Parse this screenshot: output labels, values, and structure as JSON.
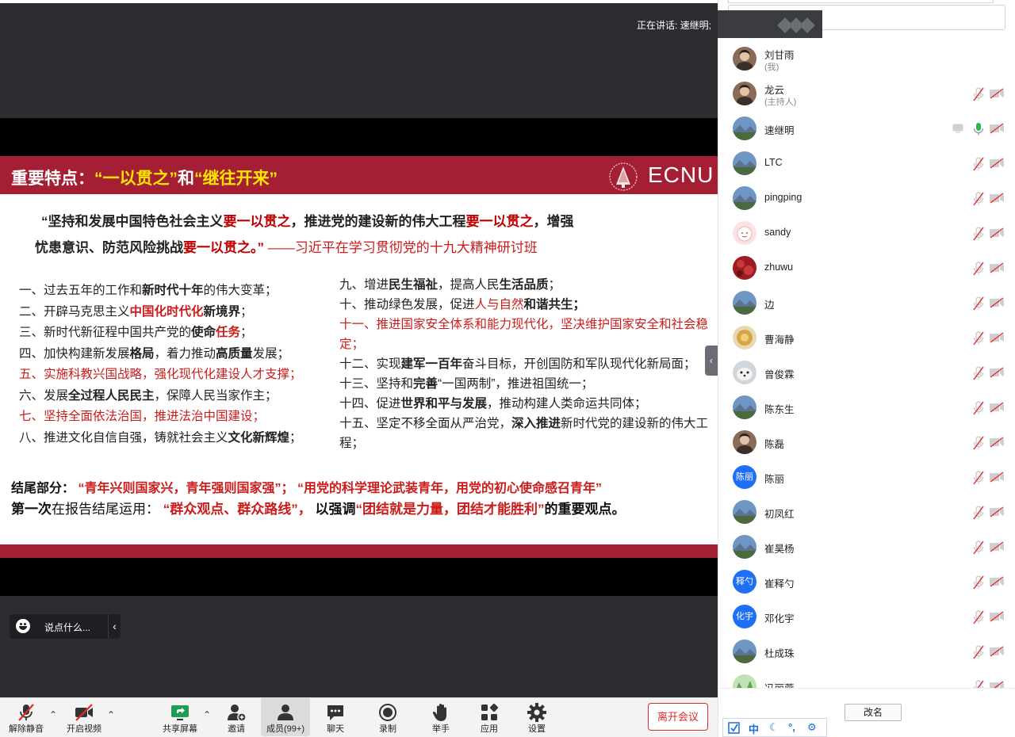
{
  "meeting": {
    "speaking_label": "正在讲话: 速继明;"
  },
  "slide": {
    "title_a": "重要特点：",
    "title_b": "“一以贯之”",
    "title_c": "和",
    "title_d": "“继往开来”",
    "logo_text": "ECNU",
    "quote": {
      "l1_a": "“坚持和发展中国特色社会主义",
      "l1_b": "要一以贯之",
      "l1_c": "，推进党的建设新的伟大工程",
      "l1_d": "要一以贯之",
      "l1_e": "，增强",
      "l2_a": "忧患意识、防范风险挑战",
      "l2_b": "要一以贯之。”",
      "l2_c": "——习近平在学习贯彻党的十九大精神研讨班"
    },
    "left_items": [
      {
        "a": "一、过去五年的工作和",
        "b": "新时代十年",
        "c": "的伟大变革；"
      },
      {
        "a": "二、开辟马克思主义",
        "b": "中国化时代化",
        "c": "新境界",
        "d": "；"
      },
      {
        "a": "三、新时代新征程中国共产党的",
        "b": "使命",
        "c": "任务",
        "d": "；"
      },
      {
        "a": "四、加快构建新发展",
        "b": "格局",
        "c": "，着力推动",
        "d": "高质量",
        "e": "发展；"
      },
      {
        "a": "五、实施科教兴国战略，强化现代化建设人才支撑；"
      },
      {
        "a": "六、发展",
        "b": "全过程人民民主",
        "c": "，保障人民当家作主；"
      },
      {
        "a": "七、坚持全面依法治国，推进法治中国建设；"
      },
      {
        "a": "八、推进文化自信自强，铸就社会主义",
        "b": "文化新辉煌",
        "c": "；"
      }
    ],
    "right_items": [
      {
        "a": "九、增进",
        "b": "民生福祉",
        "c": "，提高人民",
        "d": "生活品质",
        "e": "；"
      },
      {
        "a": "十、推动绿色发展，促进",
        "b": "人与自然",
        "c": "和谐共生",
        "d": "；"
      },
      {
        "a": "十一、推进国家安全体系和能力现代化，坚决维护国家安全和社会稳定；"
      },
      {
        "a": "十二、实现",
        "b": "建军一百年",
        "c": "奋斗目标，开创国防和军队现代化新局面；"
      },
      {
        "a": "十三、坚持和",
        "b": "完善",
        "c": "“一国两制”，推进祖国统一；"
      },
      {
        "a": "十四、促进",
        "b": "世界和平与发展",
        "c": "，推动构建人类命运共同体；"
      },
      {
        "a": "十五、坚定不移全面从严治党，",
        "b": "深入推进",
        "c": "新时代党的建设新的伟大工程；"
      }
    ],
    "ending": {
      "label": "结尾部分：",
      "q1": "“青年兴则国家兴，青年强则国家强”；",
      "q2": "“用党的科学理论武装青年，用党的初心使命感召青年”"
    },
    "first": {
      "a": "第一次",
      "b": "在报告结尾运用：",
      "c": "“群众观点、群众路线”，",
      "d": "以强调",
      "e": "“团结就是力量，团结才能胜利”",
      "f": "的重要观点。"
    }
  },
  "reaction": {
    "placeholder": "说点什么..."
  },
  "toolbar": {
    "mute": "解除静音",
    "video": "开启视频",
    "share": "共享屏幕",
    "invite": "邀请",
    "members": "成员(99+)",
    "chat": "聊天",
    "record": "录制",
    "raise_hand": "举手",
    "apps": "应用",
    "settings": "设置",
    "leave": "离开会议"
  },
  "participants": [
    {
      "name": "刘甘雨",
      "role": "(我)",
      "avatar": "photo-portrait",
      "mic": "none",
      "cam": "none"
    },
    {
      "name": "龙云",
      "role": "(主持人)",
      "avatar": "photo-portrait",
      "mic": "muted",
      "cam": "off"
    },
    {
      "name": "速继明",
      "role": "",
      "avatar": "photo-landscape",
      "mic": "on",
      "cam": "off",
      "sharing": true
    },
    {
      "name": "LTC",
      "role": "",
      "avatar": "photo-landscape",
      "mic": "muted",
      "cam": "off"
    },
    {
      "name": "pingping",
      "role": "",
      "avatar": "photo-landscape",
      "mic": "muted",
      "cam": "off"
    },
    {
      "name": "sandy",
      "role": "",
      "avatar": "photo-cartoon",
      "mic": "muted",
      "cam": "off"
    },
    {
      "name": "zhuwu",
      "role": "",
      "avatar": "photo-red",
      "mic": "muted",
      "cam": "off"
    },
    {
      "name": "边",
      "role": "",
      "avatar": "photo-landscape",
      "mic": "muted",
      "cam": "off"
    },
    {
      "name": "曹海静",
      "role": "",
      "avatar": "photo-yellow",
      "mic": "muted",
      "cam": "off"
    },
    {
      "name": "曾俊霖",
      "role": "",
      "avatar": "photo-animal",
      "mic": "muted",
      "cam": "off"
    },
    {
      "name": "陈东生",
      "role": "",
      "avatar": "photo-landscape",
      "mic": "muted",
      "cam": "off"
    },
    {
      "name": "陈磊",
      "role": "",
      "avatar": "photo-portrait",
      "mic": "muted",
      "cam": "off"
    },
    {
      "name": "陈丽",
      "role": "",
      "avatar_text": "陈丽",
      "mic": "muted",
      "cam": "off"
    },
    {
      "name": "初凤红",
      "role": "",
      "avatar": "photo-landscape",
      "mic": "muted",
      "cam": "off"
    },
    {
      "name": "崔昊杨",
      "role": "",
      "avatar": "photo-landscape",
      "mic": "muted",
      "cam": "off"
    },
    {
      "name": "崔释勺",
      "role": "",
      "avatar_text": "释勺",
      "mic": "muted",
      "cam": "off"
    },
    {
      "name": "邓化宇",
      "role": "",
      "avatar_text": "化宇",
      "mic": "muted",
      "cam": "off"
    },
    {
      "name": "杜成珠",
      "role": "",
      "avatar": "photo-landscape",
      "mic": "muted",
      "cam": "off"
    },
    {
      "name": "冯丽蓉",
      "role": "",
      "avatar": "photo-green",
      "mic": "muted",
      "cam": "off"
    }
  ],
  "panel": {
    "rename": "改名",
    "ime": [
      "中",
      "☾",
      "°,",
      "⚙"
    ]
  },
  "colors": {
    "slide_red": "#a51f34",
    "accent_red": "#cc1b1b",
    "title_yellow": "#ffe600",
    "mute_red": "#e0282d",
    "avatar_blue": "#1e6ff5"
  }
}
